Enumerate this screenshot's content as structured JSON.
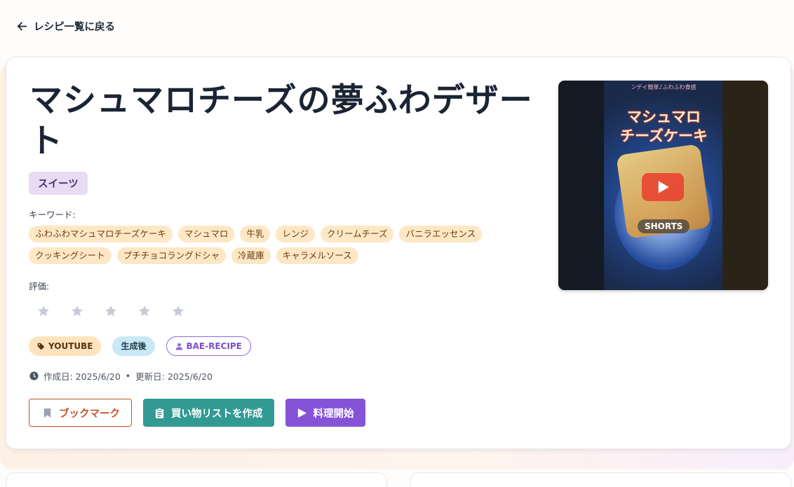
{
  "nav": {
    "back_label": "レシピ一覧に戻る"
  },
  "recipe": {
    "title": "マシュマロチーズの夢ふわデザート",
    "category": "スイーツ",
    "keywords_label": "キーワード:",
    "keywords": [
      "ふわふわマシュマロチーズケーキ",
      "マシュマロ",
      "牛乳",
      "レンジ",
      "クリームチーズ",
      "バニラエッセンス",
      "クッキングシート",
      "プチチョコラングドシャ",
      "冷蔵庫",
      "キャラメルソース"
    ],
    "rating_label": "評価:",
    "rating": 0,
    "rating_max": 5,
    "tags": {
      "source": "YOUTUBE",
      "status": "生成後",
      "user": "BAE-RECIPE"
    },
    "dates": {
      "created": "作成日: 2025/6/20",
      "separator": "•",
      "updated": "更新日: 2025/6/20"
    }
  },
  "actions": {
    "bookmark": "ブックマーク",
    "shopping_list": "買い物リストを作成",
    "start_cooking": "料理開始"
  },
  "video": {
    "overlay_top": "ンデイ簡単♪ふわふわ食感",
    "overlay_line1": "マシュマロ",
    "overlay_line2": "チーズケーキ",
    "badge": "SHORTS"
  },
  "colors": {
    "accent_orange": "#c2522a",
    "teal": "#329a93",
    "purple": "#8553d6",
    "keyword_chip": "#fde7c5",
    "category_chip": "#e8dbf4"
  },
  "icons": [
    "arrow-left-icon",
    "star-icon",
    "tag-icon",
    "user-icon",
    "clock-icon",
    "bookmark-icon",
    "clipboard-icon",
    "play-icon"
  ]
}
